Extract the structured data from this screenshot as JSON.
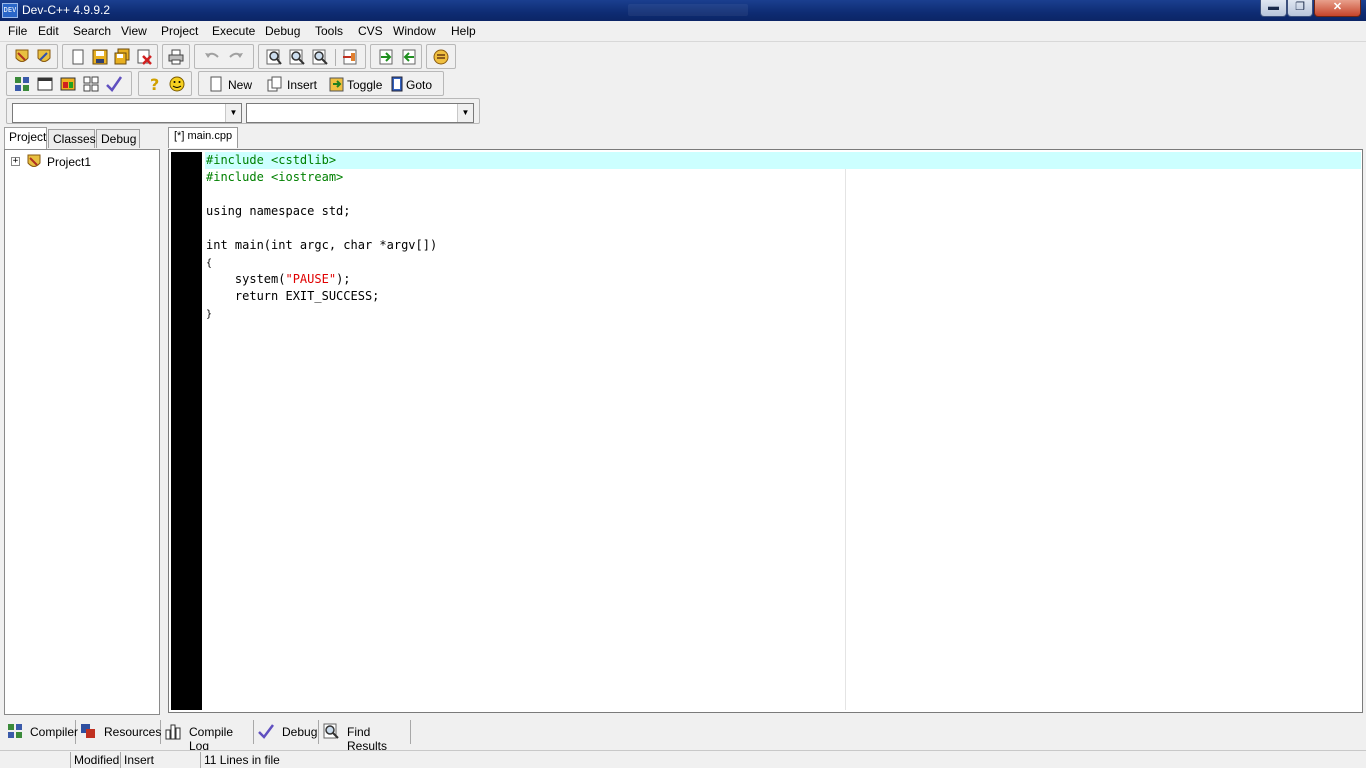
{
  "window": {
    "title": "Dev-C++ 4.9.9.2",
    "app_icon_text": "DEV"
  },
  "menu": [
    "File",
    "Edit",
    "Search",
    "View",
    "Project",
    "Execute",
    "Debug",
    "Tools",
    "CVS",
    "Window",
    "Help"
  ],
  "toolbar": {
    "new_label": "New",
    "insert_label": "Insert",
    "toggle_label": "Toggle",
    "goto_label": "Goto",
    "combo1_value": "",
    "combo2_value": ""
  },
  "left_panel": {
    "tabs": [
      "Project",
      "Classes",
      "Debug"
    ],
    "active_tab": "Project",
    "tree": [
      {
        "label": "Project1",
        "expander": "+"
      }
    ]
  },
  "editor": {
    "tab_label": "[*] main.cpp",
    "lines": [
      {
        "segments": [
          {
            "text": "#include <cstdlib>",
            "cls": "pre"
          }
        ]
      },
      {
        "segments": [
          {
            "text": "#include <iostream>",
            "cls": "pre"
          }
        ]
      },
      {
        "segments": []
      },
      {
        "segments": [
          {
            "text": "using namespace std;",
            "cls": "plain"
          }
        ]
      },
      {
        "segments": []
      },
      {
        "segments": [
          {
            "text": "int main(int argc, char *argv[])",
            "cls": "plain"
          }
        ]
      },
      {
        "segments": [
          {
            "text": "{",
            "cls": "brace"
          }
        ]
      },
      {
        "segments": [
          {
            "text": "    system(",
            "cls": "plain"
          },
          {
            "text": "\"PAUSE\"",
            "cls": "str"
          },
          {
            "text": ");",
            "cls": "plain"
          }
        ]
      },
      {
        "segments": [
          {
            "text": "    return EXIT_SUCCESS;",
            "cls": "plain"
          }
        ]
      },
      {
        "segments": [
          {
            "text": "}",
            "cls": "brace"
          }
        ]
      }
    ]
  },
  "bottom_tabs": [
    "Compiler",
    "Resources",
    "Compile Log",
    "Debug",
    "Find Results"
  ],
  "status": {
    "cell1": "",
    "modified": "Modified",
    "mode": "Insert",
    "lines": "11 Lines in file"
  }
}
